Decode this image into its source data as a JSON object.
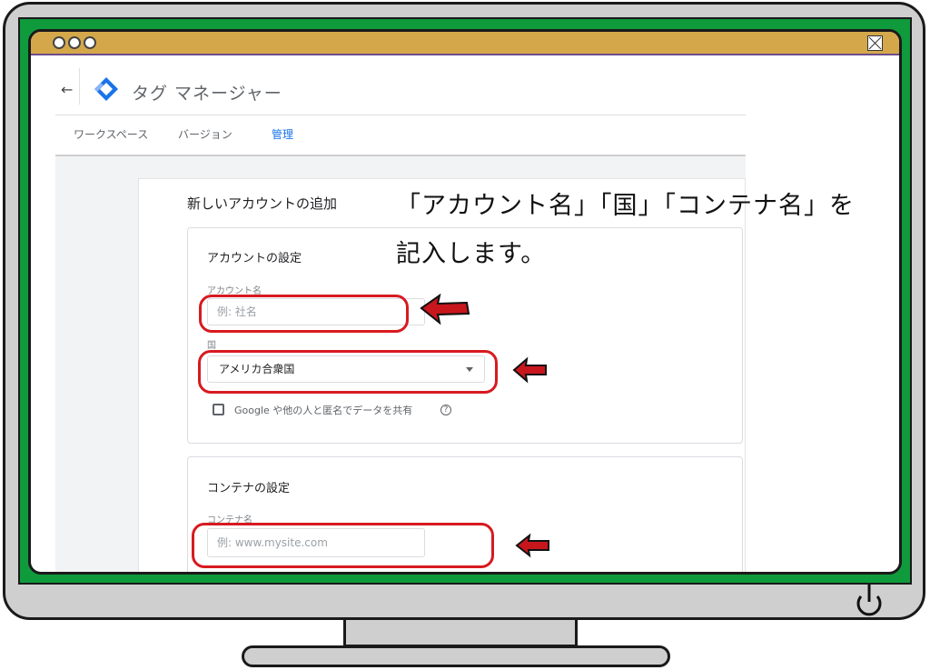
{
  "app": {
    "title": "タグ マネージャー",
    "back_icon": "arrow-back-icon",
    "logo_icon": "gtm-diamond-logo",
    "colors": {
      "logo_blue": "#1a73e8",
      "logo_light": "#8ab4f8",
      "highlight": "#d71a20",
      "frame_green": "#0f9a3c",
      "titlebar": "#d4a84a"
    }
  },
  "nav": {
    "workspace": "ワークスペース",
    "version": "バージョン",
    "admin": "管理"
  },
  "form": {
    "title": "新しいアカウントの追加",
    "account_section": {
      "title": "アカウントの設定",
      "account_name_label": "アカウント名",
      "account_name_placeholder": "例: 社名",
      "country_label": "国",
      "country_value": "アメリカ合衆国",
      "share_label": "Google や他の人と匿名でデータを共有"
    },
    "container_section": {
      "title": "コンテナの設定",
      "container_name_label": "コンテナ名",
      "container_name_placeholder": "例: www.mysite.com"
    }
  },
  "annotation": {
    "line1": "「アカウント名」「国」「コンテナ名」を",
    "line2": "記入します。"
  }
}
